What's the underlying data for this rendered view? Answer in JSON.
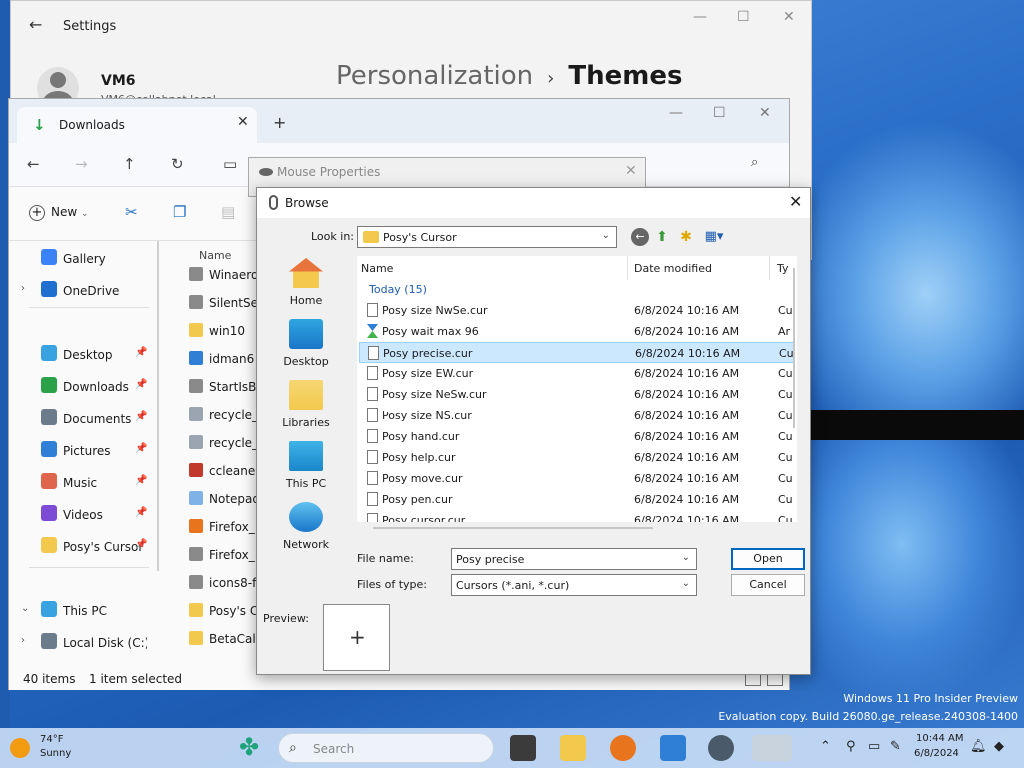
{
  "settings": {
    "title": "Settings",
    "user_name": "VM6",
    "user_email": "VM6@collabnet.local",
    "breadcrumb_parent": "Personalization",
    "breadcrumb_sep": "›",
    "breadcrumb_current": "Themes"
  },
  "explorer": {
    "tab_label": "Downloads",
    "new_label": "New",
    "sidebar": [
      {
        "label": "Gallery",
        "chevron": "",
        "pin": "",
        "color": "#3b82f6"
      },
      {
        "label": "OneDrive",
        "chevron": "›",
        "pin": "",
        "color": "#1f6fd0"
      },
      {
        "label": "Desktop",
        "chevron": "",
        "pin": "📌",
        "color": "#38a3e0"
      },
      {
        "label": "Downloads",
        "chevron": "",
        "pin": "📌",
        "color": "#2aa24a"
      },
      {
        "label": "Documents",
        "chevron": "",
        "pin": "📌",
        "color": "#6b7b8c"
      },
      {
        "label": "Pictures",
        "chevron": "",
        "pin": "📌",
        "color": "#2f7fd6"
      },
      {
        "label": "Music",
        "chevron": "",
        "pin": "📌",
        "color": "#e0654d"
      },
      {
        "label": "Videos",
        "chevron": "",
        "pin": "📌",
        "color": "#7d4cd6"
      },
      {
        "label": "Posy's Cursor",
        "chevron": "",
        "pin": "📌",
        "color": "#f2c94c"
      },
      {
        "label": "This PC",
        "chevron": "⌄",
        "pin": "",
        "color": "#38a3e0"
      },
      {
        "label": "Local Disk (C:)",
        "chevron": "›",
        "pin": "",
        "color": "#6b7b8c"
      }
    ],
    "list_header": "Name",
    "files": [
      {
        "name": "Winaero",
        "color": "#8a8a8a"
      },
      {
        "name": "SilentSe",
        "color": "#8a8a8a"
      },
      {
        "name": "win10",
        "color": "#f2c94c"
      },
      {
        "name": "idman6",
        "color": "#2f7fd6"
      },
      {
        "name": "StartIsBa",
        "color": "#8a8a8a"
      },
      {
        "name": "recycle_",
        "color": "#9aa5b1"
      },
      {
        "name": "recycle_",
        "color": "#9aa5b1"
      },
      {
        "name": "ccleaner",
        "color": "#c0392b"
      },
      {
        "name": "Notepad",
        "color": "#7fb3e8"
      },
      {
        "name": "Firefox_",
        "color": "#e8741e"
      },
      {
        "name": "Firefox_",
        "color": "#8a8a8a"
      },
      {
        "name": "icons8-f",
        "color": "#8a8a8a"
      },
      {
        "name": "Posy's Cu",
        "color": "#f2c94c"
      },
      {
        "name": "BetaCalcu",
        "color": "#f2c94c"
      }
    ],
    "status_items": "40 items",
    "status_selected": "1 item selected"
  },
  "mouse_properties": {
    "title": "Mouse Properties"
  },
  "browse": {
    "title": "Browse",
    "look_in_label": "Look in:",
    "look_in_value": "Posy's Cursor",
    "places": [
      {
        "label": "Home"
      },
      {
        "label": "Desktop"
      },
      {
        "label": "Libraries"
      },
      {
        "label": "This PC"
      },
      {
        "label": "Network"
      }
    ],
    "columns": {
      "name": "Name",
      "date": "Date modified",
      "type": "Ty"
    },
    "group": "Today (15)",
    "files": [
      {
        "name": "Posy size NwSe.cur",
        "date": "6/8/2024 10:16 AM",
        "type": "Cu",
        "animated": false,
        "selected": false
      },
      {
        "name": "Posy wait max 96",
        "date": "6/8/2024 10:16 AM",
        "type": "Ar",
        "animated": true,
        "selected": false
      },
      {
        "name": "Posy precise.cur",
        "date": "6/8/2024 10:16 AM",
        "type": "Cu",
        "animated": false,
        "selected": true
      },
      {
        "name": "Posy size EW.cur",
        "date": "6/8/2024 10:16 AM",
        "type": "Cu",
        "animated": false,
        "selected": false
      },
      {
        "name": "Posy size NeSw.cur",
        "date": "6/8/2024 10:16 AM",
        "type": "Cu",
        "animated": false,
        "selected": false
      },
      {
        "name": "Posy size NS.cur",
        "date": "6/8/2024 10:16 AM",
        "type": "Cu",
        "animated": false,
        "selected": false
      },
      {
        "name": "Posy hand.cur",
        "date": "6/8/2024 10:16 AM",
        "type": "Cu",
        "animated": false,
        "selected": false
      },
      {
        "name": "Posy help.cur",
        "date": "6/8/2024 10:16 AM",
        "type": "Cu",
        "animated": false,
        "selected": false
      },
      {
        "name": "Posy move.cur",
        "date": "6/8/2024 10:16 AM",
        "type": "Cu",
        "animated": false,
        "selected": false
      },
      {
        "name": "Posy pen.cur",
        "date": "6/8/2024 10:16 AM",
        "type": "Cu",
        "animated": false,
        "selected": false
      },
      {
        "name": "Posy cursor.cur",
        "date": "6/8/2024 10:16 AM",
        "type": "Cu",
        "animated": false,
        "selected": false
      }
    ],
    "file_name_label": "File name:",
    "file_name_value": "Posy precise",
    "files_of_type_label": "Files of type:",
    "files_of_type_value": "Cursors (*.ani, *.cur)",
    "open_label": "Open",
    "cancel_label": "Cancel",
    "preview_label": "Preview:"
  },
  "watermark": {
    "line1": "Windows 11 Pro Insider Preview",
    "line2": "Evaluation copy. Build 26080.ge_release.240308-1400"
  },
  "taskbar": {
    "temperature": "74°F",
    "condition": "Sunny",
    "search_placeholder": "Search",
    "time": "10:44 AM",
    "date": "6/8/2024"
  }
}
